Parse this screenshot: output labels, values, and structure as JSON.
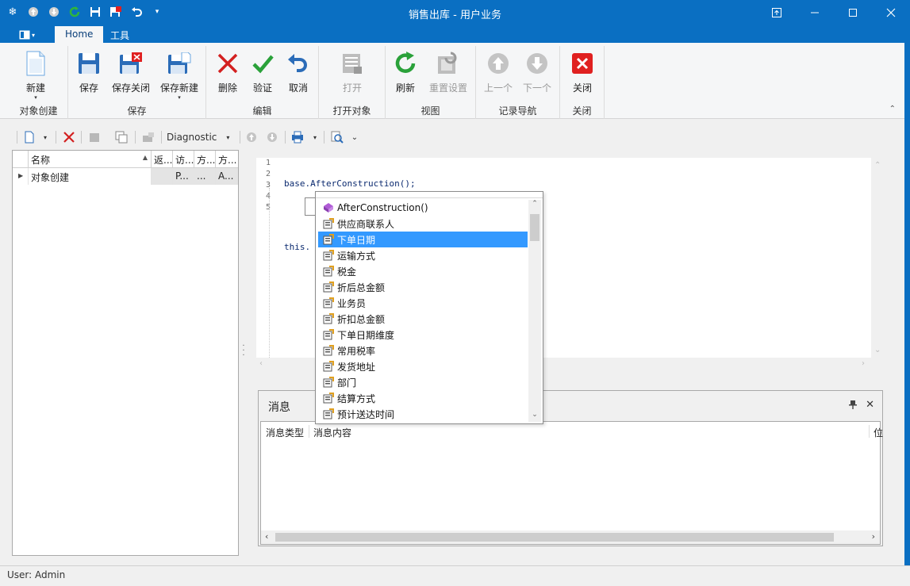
{
  "window": {
    "title": "销售出库 - 用户业务",
    "accent": "#0a6fc2"
  },
  "tabs": [
    {
      "label": "Home",
      "active": true
    },
    {
      "label": "工具",
      "active": false
    }
  ],
  "ribbon": {
    "groups": [
      {
        "label": "对象创建",
        "buttons": [
          {
            "label": "新建",
            "icon": "new-document-icon",
            "dropdown": true
          }
        ]
      },
      {
        "label": "保存",
        "buttons": [
          {
            "label": "保存",
            "icon": "save-icon"
          },
          {
            "label": "保存关闭",
            "icon": "save-close-icon"
          },
          {
            "label": "保存新建",
            "icon": "save-new-icon",
            "dropdown": true
          }
        ]
      },
      {
        "label": "编辑",
        "buttons": [
          {
            "label": "删除",
            "icon": "delete-icon"
          },
          {
            "label": "验证",
            "icon": "validate-icon"
          },
          {
            "label": "取消",
            "icon": "undo-icon"
          }
        ]
      },
      {
        "label": "打开对象",
        "buttons": [
          {
            "label": "打开",
            "icon": "open-object-icon",
            "disabled": true
          }
        ]
      },
      {
        "label": "视图",
        "buttons": [
          {
            "label": "刷新",
            "icon": "refresh-icon"
          },
          {
            "label": "重置设置",
            "icon": "reset-settings-icon",
            "disabled": true
          }
        ]
      },
      {
        "label": "记录导航",
        "buttons": [
          {
            "label": "上一个",
            "icon": "previous-record-icon",
            "disabled": true
          },
          {
            "label": "下一个",
            "icon": "next-record-icon",
            "disabled": true
          }
        ]
      },
      {
        "label": "关闭",
        "buttons": [
          {
            "label": "关闭",
            "icon": "close-window-icon"
          }
        ]
      }
    ]
  },
  "toolbar": {
    "combo_label": "Diagnostic"
  },
  "tree": {
    "columns": [
      "名称",
      "返...",
      "访...",
      "方...",
      "方..."
    ],
    "rows": [
      {
        "cells": [
          "对象创建",
          "",
          "P...",
          "...",
          "A..."
        ]
      }
    ]
  },
  "editor": {
    "line_numbers": [
      "1",
      "2",
      "3",
      "4",
      "5"
    ],
    "lines": [
      "base.AfterConstruction();",
      "",
      "this.",
      "",
      ""
    ]
  },
  "autocomplete": {
    "selected_index": 2,
    "items": [
      {
        "label": "AfterConstruction()",
        "kind": "method-icon"
      },
      {
        "label": "供应商联系人",
        "kind": "property-icon"
      },
      {
        "label": "下单日期",
        "kind": "property-icon"
      },
      {
        "label": "运输方式",
        "kind": "property-icon"
      },
      {
        "label": "税金",
        "kind": "property-icon"
      },
      {
        "label": "折后总金额",
        "kind": "property-icon"
      },
      {
        "label": "业务员",
        "kind": "property-icon"
      },
      {
        "label": "折扣总金额",
        "kind": "property-icon"
      },
      {
        "label": "下单日期维度",
        "kind": "property-icon"
      },
      {
        "label": "常用税率",
        "kind": "property-icon"
      },
      {
        "label": "发货地址",
        "kind": "property-icon"
      },
      {
        "label": "部门",
        "kind": "property-icon"
      },
      {
        "label": "结算方式",
        "kind": "property-icon"
      },
      {
        "label": "预计送达时间",
        "kind": "property-icon"
      }
    ]
  },
  "messages": {
    "title": "消息",
    "columns": [
      "消息类型",
      "消息内容",
      "位"
    ]
  },
  "status": {
    "user_text": "User: Admin"
  }
}
